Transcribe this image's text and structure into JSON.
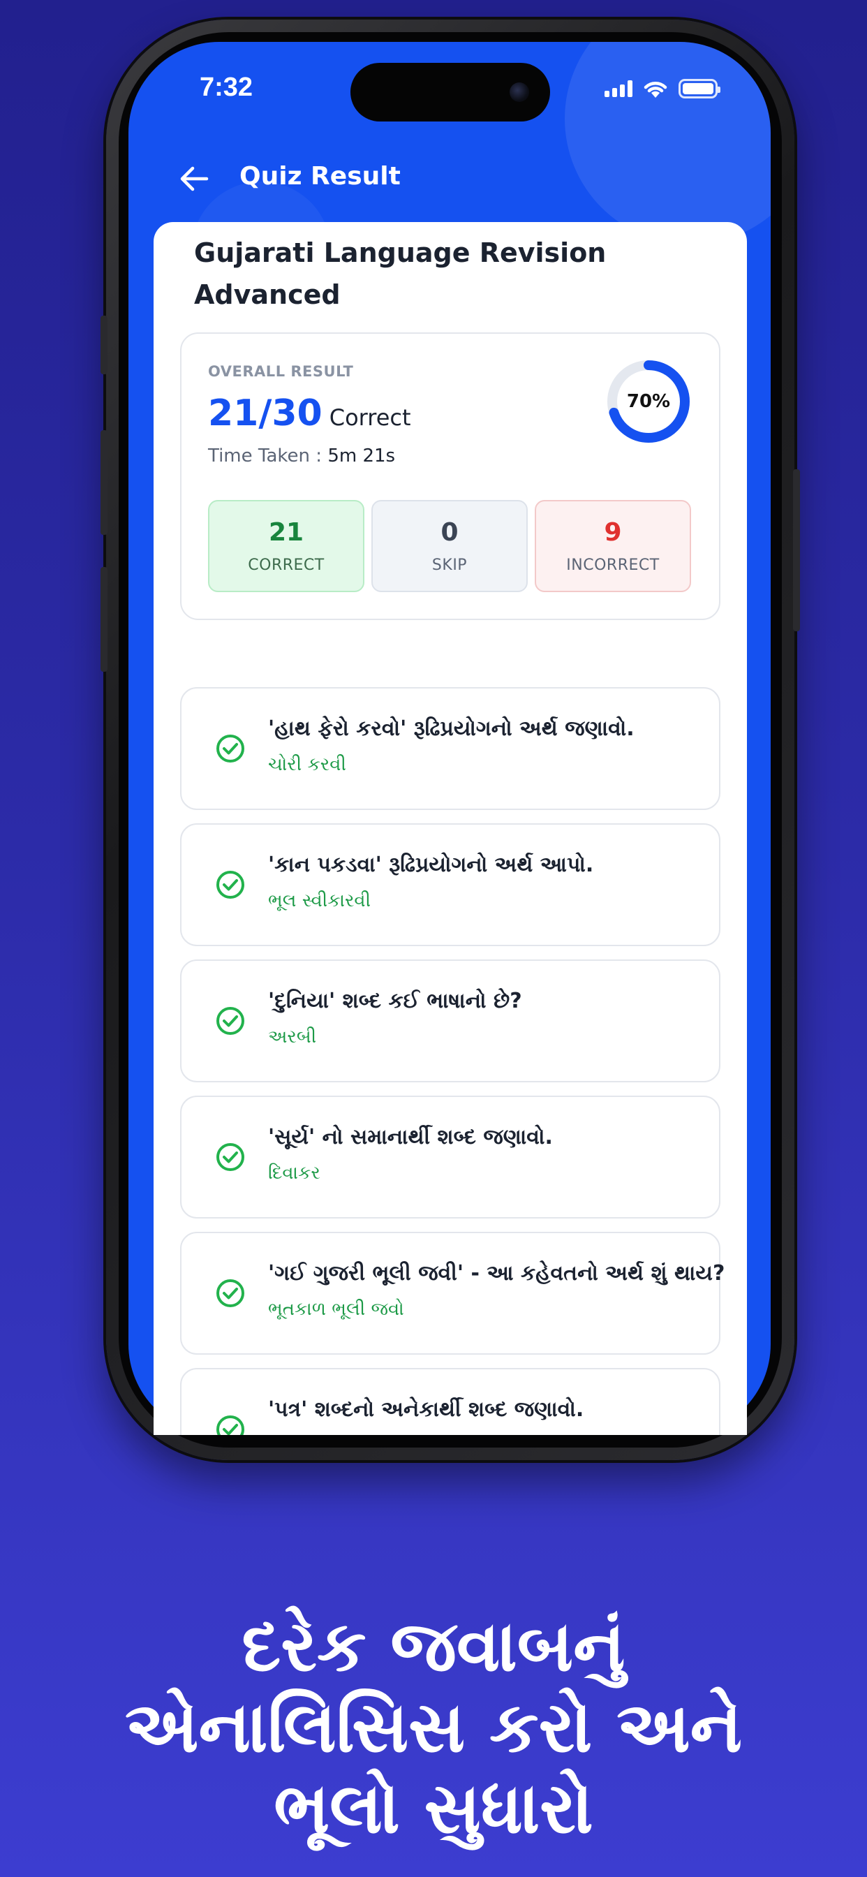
{
  "status_bar": {
    "time": "7:32"
  },
  "header": {
    "title": "Quiz Result"
  },
  "quiz": {
    "title": "Gujarati Language Revision Advanced",
    "overall_label": "OVERALL RESULT",
    "score": "21/30",
    "score_suffix": "Correct",
    "time_label": "Time Taken :",
    "time_value": "5m 21s",
    "percent": 70,
    "percent_label": "70%"
  },
  "stats": {
    "correct": {
      "value": "21",
      "label": "CORRECT"
    },
    "skip": {
      "value": "0",
      "label": "SKIP"
    },
    "incorrect": {
      "value": "9",
      "label": "INCORRECT"
    }
  },
  "questions": [
    {
      "question": "'હાથ ફેરો કરવો' રૂઢિપ્રયોગનો અર્થ જણાવો.",
      "answer": "ચોરી કરવી"
    },
    {
      "question": "'કાન પકડવા' રૂઢિપ્રયોગનો અર્થ આપો.",
      "answer": "ભૂલ સ્વીકારવી"
    },
    {
      "question": "'દુનિયા' શબ્દ કઈ ભાષાનો છે?",
      "answer": "અરબી"
    },
    {
      "question": "'સૂર્ય' નો સમાનાર્થી શબ્દ જણાવો.",
      "answer": "દિવાકર"
    },
    {
      "question": "'ગઈ ગુજરી ભૂલી જવી' - આ કહેવતનો અર્થ શું થાય?",
      "answer": "ભૂતકાળ ભૂલી જવો"
    },
    {
      "question": "'પત્ર' શબ્દનો અનેકાર્થી શબ્દ જણાવો.",
      "answer": ""
    }
  ],
  "caption": {
    "line1": "દરેક જવાબનું",
    "line2": "એનાલિસિસ કરો અને",
    "line3": "ભૂલો સુધારો"
  },
  "colors": {
    "primary": "#1551f0",
    "correct": "#1d9a47",
    "incorrect": "#e0312f",
    "background": "#2a2aa8"
  },
  "icons": {
    "back": "arrow-left-icon",
    "check": "check-circle-icon",
    "wifi": "wifi-icon",
    "signal": "signal-icon",
    "battery": "battery-icon"
  }
}
